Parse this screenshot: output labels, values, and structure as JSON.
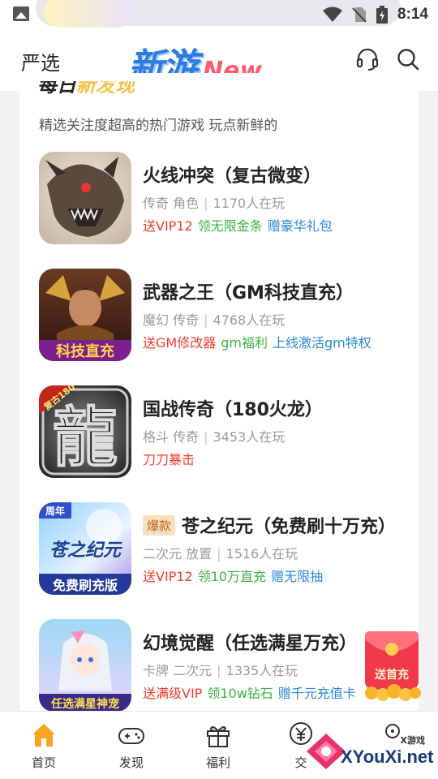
{
  "status_bar": {
    "time": "8:14",
    "icons": [
      "image-icon",
      "wifi-icon",
      "no-sim-icon",
      "battery-icon"
    ]
  },
  "header": {
    "left_label": "严选",
    "logo_cn": "新游",
    "logo_en": "New",
    "icons": [
      "headset-icon",
      "search-icon"
    ]
  },
  "section": {
    "title_part1": "每日",
    "title_part2": "新发现",
    "subtitle": "精选关注度超高的热门游戏 玩点新鲜的"
  },
  "games": [
    {
      "name": "火线冲突（复古微变）",
      "badge": "",
      "tag1": "传奇",
      "tag2": "角色",
      "players": "1170人在玩",
      "perks": [
        {
          "text": "送VIP12",
          "color": "red"
        },
        {
          "text": "领无限金条",
          "color": "green"
        },
        {
          "text": "赠豪华礼包",
          "color": "blue"
        }
      ]
    },
    {
      "name": "武器之王（GM科技直充）",
      "badge": "",
      "tag1": "魔幻",
      "tag2": "传奇",
      "players": "4768人在玩",
      "icon_text": "科技直充",
      "perks": [
        {
          "text": "送GM修改器",
          "color": "red"
        },
        {
          "text": "gm福利",
          "color": "green"
        },
        {
          "text": "上线激活gm特权",
          "color": "blue"
        }
      ]
    },
    {
      "name": "国战传奇（180火龙）",
      "badge": "",
      "tag1": "格斗",
      "tag2": "传奇",
      "players": "3453人在玩",
      "icon_text": "龍",
      "icon_corner": "复古180",
      "perks": [
        {
          "text": "刀刀暴击",
          "color": "red"
        }
      ]
    },
    {
      "name": "苍之纪元（免费刷十万充）",
      "badge": "爆款",
      "tag1": "二次元",
      "tag2": "放置",
      "players": "1516人在玩",
      "icon_text": "苍之纪元",
      "icon_banner": "免费刷充版",
      "icon_corner": "周年",
      "perks": [
        {
          "text": "送VIP12",
          "color": "red"
        },
        {
          "text": "领10万直充",
          "color": "green"
        },
        {
          "text": "赠无限抽",
          "color": "blue"
        }
      ]
    },
    {
      "name": "幻境觉醒（任选满星万充）",
      "badge": "",
      "tag1": "卡牌",
      "tag2": "二次元",
      "players": "1335人在玩",
      "icon_banner": "任选满星神宠",
      "perks": [
        {
          "text": "送满级VIP",
          "color": "red"
        },
        {
          "text": "领10w钻石",
          "color": "green"
        },
        {
          "text": "赠千元充值卡",
          "color": "blue"
        }
      ]
    }
  ],
  "float_gift": {
    "label": "送首充"
  },
  "bottom_nav": [
    {
      "label": "首页",
      "icon": "home-icon",
      "active": true
    },
    {
      "label": "发现",
      "icon": "gamepad-icon",
      "active": false
    },
    {
      "label": "福利",
      "icon": "gift-icon",
      "active": false
    },
    {
      "label": "交",
      "icon": "yen-icon",
      "active": false
    },
    {
      "label": "",
      "icon": "profile-icon",
      "active": false
    }
  ],
  "watermark": {
    "small": "X游戏",
    "main": "XYouXi.net"
  },
  "colors": {
    "accent_orange": "#f6a623",
    "perk_red": "#f23a2e",
    "perk_green": "#3cb043",
    "perk_blue": "#2a86d8",
    "logo_blue": "#2c7be5",
    "logo_pink": "#ff5b6e"
  }
}
